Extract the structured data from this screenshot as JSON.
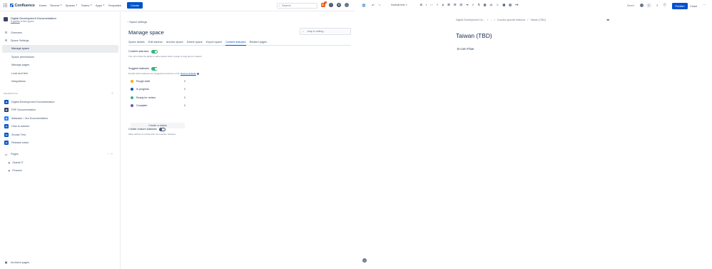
{
  "topnav": {
    "brand": "Confluence",
    "items": [
      {
        "label": "Home",
        "caret": false
      },
      {
        "label": "Recent",
        "caret": true
      },
      {
        "label": "Spaces",
        "caret": true
      },
      {
        "label": "Teams",
        "caret": true
      },
      {
        "label": "Apps",
        "caret": true
      },
      {
        "label": "Templates",
        "caret": false
      }
    ],
    "create_label": "Create",
    "search_placeholder": "Search",
    "notification_count": "9+"
  },
  "sidebar": {
    "space_title": "Digital Development Documentation",
    "space_sub_link": "8 guests",
    "space_sub_rest": " in this space",
    "overview": "Overview",
    "space_settings": "Space Settings",
    "settings_items": [
      "Manage space",
      "Space permissions",
      "Manage pages",
      "Look and feel",
      "Integrations"
    ],
    "shortcuts_label": "SHORTCUTS",
    "shortcuts": [
      "Digital Development Documentation",
      "FRF Documentation",
      "Atlassian / Jira Documentation",
      "How-to articles",
      "Smoke Test",
      "Release notes"
    ],
    "pages_label": "Pages",
    "page_tree": [
      "Global IT",
      "Finance"
    ],
    "archived": "Archived pages"
  },
  "settings": {
    "back": "Space settings",
    "title": "Manage space",
    "jump_placeholder": "Jump to setting...",
    "tabs": [
      "Space details",
      "Edit sidebar",
      "Archive space",
      "Delete space",
      "Export space",
      "Content statuses",
      "Related pages"
    ],
    "active_tab": "Content statuses",
    "content_statuses": {
      "title": "Content statuses",
      "enabled": true,
      "desc": "Turn off to hide the ability to add a status when a page or blog post is created"
    },
    "suggest_statuses": {
      "title": "Suggest statuses",
      "enabled": true,
      "desc_prefix": "Decide which statuses are suggested (maximum of 5). ",
      "desc_link": "Restore defaults"
    },
    "statuses": [
      {
        "name": "Rough draft",
        "count": "0",
        "color": "#ffab00"
      },
      {
        "name": "In progress",
        "count": "0",
        "color": "#0052cc"
      },
      {
        "name": "Ready for review",
        "count": "0",
        "color": "#36b37e"
      },
      {
        "name": "Complete",
        "count": "0",
        "color": "#6554c0"
      }
    ],
    "create_status": "Create a status",
    "custom_statuses": {
      "title": "Create custom statuses",
      "enabled": false,
      "desc": "Allow authors to create their own custom statuses"
    }
  },
  "editor": {
    "text_style": "Normal text",
    "saved": "Saved",
    "publish": "Publish",
    "close": "Close",
    "breadcrumbs": [
      "Digital Development Do...",
      "/",
      "...",
      "/",
      "Country specific features",
      "/",
      "Taiwan (TBD)"
    ],
    "page_title": "Taiwan (TBD)",
    "body": "E-com Flow"
  },
  "colors": {
    "brand": "#0052cc",
    "toggle_on": "#36b37e"
  }
}
